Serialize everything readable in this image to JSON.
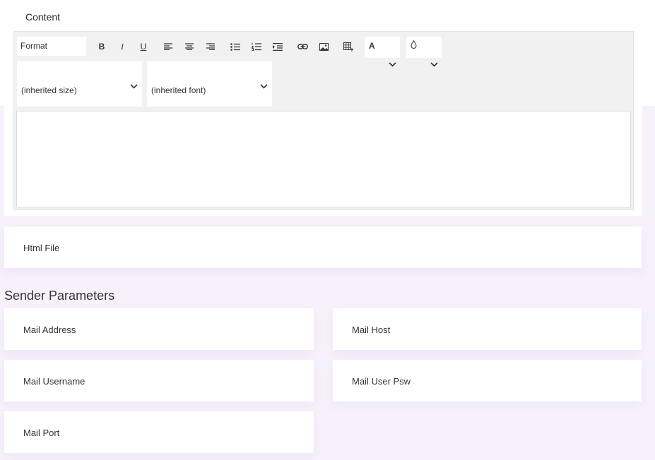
{
  "content": {
    "label": "Content",
    "toolbar": {
      "format_label": "Format",
      "bold": "B",
      "italic": "I",
      "underline": "U",
      "font_color_glyph": "A",
      "size_value": "(inherited size)",
      "font_value": "(inherited font)"
    }
  },
  "html_file": {
    "label": "Html File"
  },
  "sender": {
    "title": "Sender Parameters",
    "mail_address": "Mail Address",
    "mail_host": "Mail Host",
    "mail_username": "Mail Username",
    "mail_user_psw": "Mail User Psw",
    "mail_port": "Mail Port"
  }
}
